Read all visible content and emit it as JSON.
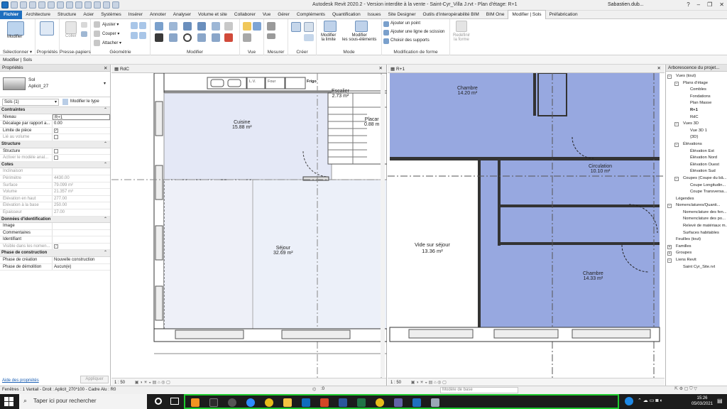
{
  "window": {
    "title": "Autodesk Revit 2020.2 - Version interdite à la vente - Saint-Cyr_Villa J.rvt - Plan d'étage: R+1",
    "user": "Sabastien.dub..."
  },
  "ribbon_tabs": [
    "Fichier",
    "Architecture",
    "Structure",
    "Acier",
    "Systèmes",
    "Insérer",
    "Annoter",
    "Analyser",
    "Volume et site",
    "Collaborer",
    "Vue",
    "Gérer",
    "Compléments",
    "Quantification",
    "Issues",
    "Site Designer",
    "Outils d'interopérabilité BIM",
    "BIM One",
    "Modifier | Sols",
    "Préfabrication"
  ],
  "ribbon": {
    "modify_label": "Modifier",
    "select_label": "Sélectionner ▾",
    "properties_label": "Propriétés",
    "clipboard_label": "Presse-papiers",
    "paste_label": "Coller",
    "geometry_label": "Géométrie",
    "geom_items": [
      "Ajuster ▾",
      "Couper ▾",
      "Attacher ▾"
    ],
    "modify_group_label": "Modifier",
    "view_label": "Vue",
    "measure_label": "Mesurer",
    "create_label": "Créer",
    "mode_label": "Mode",
    "edit_boundary": [
      "Modifier",
      "la limite"
    ],
    "edit_subelements": [
      "Modifier",
      "les sous-éléments"
    ],
    "shape_items": [
      "Ajouter un point",
      "Ajouter une ligne de scission",
      "Choisir des supports"
    ],
    "shape_group_label": "Modification de forme",
    "reset_shape": [
      "Redéfinir",
      "la forme"
    ]
  },
  "options_bar": "Modifier | Sols",
  "properties": {
    "title": "Propriétés",
    "type_family": "Sol",
    "type_name": "Aplicit_27",
    "selector": "Sols (1)",
    "edit_type": "Modifier le type",
    "sections": [
      {
        "name": "Contraintes",
        "rows": [
          {
            "k": "Niveau",
            "v": "R+1"
          },
          {
            "k": "Décalage par rapport a...",
            "v": "0.00"
          },
          {
            "k": "Limite de pièce",
            "v": "✓",
            "cb": true
          },
          {
            "k": "Lié au volume",
            "v": "",
            "cb": true,
            "dim": true
          }
        ]
      },
      {
        "name": "Structure",
        "rows": [
          {
            "k": "Structure",
            "v": "",
            "cb": true
          },
          {
            "k": "Activer le modèle anal...",
            "v": "",
            "cb": true,
            "dim": true
          }
        ]
      },
      {
        "name": "Cotes",
        "rows": [
          {
            "k": "Inclinaison",
            "v": "",
            "dim": true
          },
          {
            "k": "Périmètre",
            "v": "4430.00",
            "dim": true
          },
          {
            "k": "Surface",
            "v": "79.099 m²",
            "dim": true
          },
          {
            "k": "Volume",
            "v": "21.357 m³",
            "dim": true
          },
          {
            "k": "Élévation en haut",
            "v": "277.00",
            "dim": true
          },
          {
            "k": "Élévation à la base",
            "v": "250.00",
            "dim": true
          },
          {
            "k": "Épaisseur",
            "v": "27.00",
            "dim": true
          }
        ]
      },
      {
        "name": "Données d'identification",
        "rows": [
          {
            "k": "Image",
            "v": ""
          },
          {
            "k": "Commentaires",
            "v": ""
          },
          {
            "k": "Identifiant",
            "v": ""
          },
          {
            "k": "Visible dans les nomen...",
            "v": "✓",
            "cb": true,
            "dim": true
          }
        ]
      },
      {
        "name": "Phase de construction",
        "rows": [
          {
            "k": "Phase de création",
            "v": "Nouvelle construction"
          },
          {
            "k": "Phase de démolition",
            "v": "Aucun(e)"
          }
        ]
      }
    ],
    "help_link": "Aide des propriétés",
    "apply": "Appliquer"
  },
  "view_left": {
    "tab": "RdC",
    "scale": "1 : 50",
    "rooms": [
      {
        "name": "Cuisine",
        "area": "15.88 m²"
      },
      {
        "name": "Escalier",
        "area": "2.73 m²"
      },
      {
        "name": "Placar",
        "area": "0.88 m"
      },
      {
        "name": "Séjour",
        "area": "32.69 m²"
      }
    ],
    "fixtures": [
      "L.V.",
      "Four",
      "Frigo"
    ]
  },
  "view_right": {
    "tab": "R+1",
    "scale": "1 : 50",
    "rooms": [
      {
        "name": "Chambre",
        "area": "14.20 m²"
      },
      {
        "name": "Circulation",
        "area": "10.10 m²"
      },
      {
        "name": "Vide sur séjour",
        "area": "13.36 m²"
      },
      {
        "name": "Chambre",
        "area": "14.33 m²"
      }
    ]
  },
  "browser": {
    "title": "Arborescence du projet...",
    "items": [
      {
        "t": "Vues (tout)",
        "lvl": 0,
        "exp": "−"
      },
      {
        "t": "Plans d'étage",
        "lvl": 1,
        "exp": "−"
      },
      {
        "t": "Combles",
        "lvl": 2
      },
      {
        "t": "Fondations",
        "lvl": 2
      },
      {
        "t": "Plan Masse",
        "lvl": 2
      },
      {
        "t": "R+1",
        "lvl": 2,
        "bold": true
      },
      {
        "t": "RdC",
        "lvl": 2
      },
      {
        "t": "Vues 3D",
        "lvl": 1,
        "exp": "−"
      },
      {
        "t": "Vue 3D 1",
        "lvl": 2
      },
      {
        "t": "{3D}",
        "lvl": 2
      },
      {
        "t": "Élévations",
        "lvl": 1,
        "exp": "−"
      },
      {
        "t": "Élévation Est",
        "lvl": 2
      },
      {
        "t": "Élévation Nord",
        "lvl": 2
      },
      {
        "t": "Élévation Ouest",
        "lvl": 2
      },
      {
        "t": "Élévation Sud",
        "lvl": 2
      },
      {
        "t": "Coupes (Coupe du bâ...",
        "lvl": 1,
        "exp": "−"
      },
      {
        "t": "Coupe Longitudin...",
        "lvl": 2
      },
      {
        "t": "Coupe Transversa...",
        "lvl": 2
      },
      {
        "t": "Légendes",
        "lvl": 0
      },
      {
        "t": "Nomenclatures/Quanti...",
        "lvl": 0,
        "exp": "−"
      },
      {
        "t": "Nomenclature des fen...",
        "lvl": 1
      },
      {
        "t": "Nomenclature des po...",
        "lvl": 1
      },
      {
        "t": "Relevé de matériaux m...",
        "lvl": 1
      },
      {
        "t": "Surfaces habitables",
        "lvl": 1
      },
      {
        "t": "Feuilles (tout)",
        "lvl": 0
      },
      {
        "t": "Familles",
        "lvl": 0,
        "exp": "+"
      },
      {
        "t": "Groupes",
        "lvl": 0,
        "exp": "+"
      },
      {
        "t": "Liens Revit",
        "lvl": 0,
        "exp": "−"
      },
      {
        "t": "Saint Cyr_Site.rvt",
        "lvl": 1
      }
    ]
  },
  "statusbar": {
    "text": "Fenêtres : 1 Vantail - Droit : Aplicit_270*100 - Cadre Alu : R0",
    "zoom": ":0",
    "model": "Modèle de base"
  },
  "taskbar": {
    "search_placeholder": "Taper ici pour rechercher",
    "time": "15:26",
    "date": "05/03/2021"
  }
}
